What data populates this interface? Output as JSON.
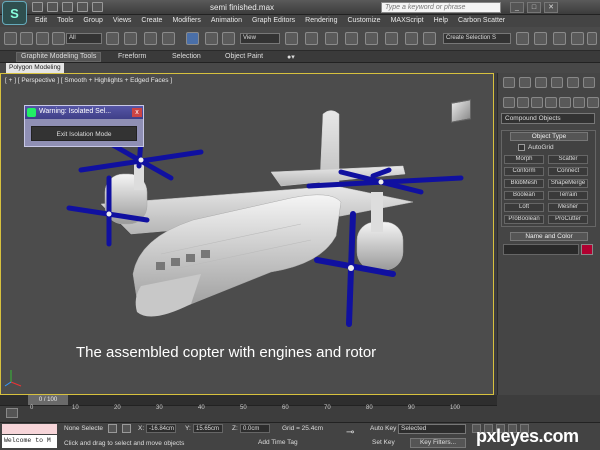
{
  "title": "semi finished.max",
  "app_logo": "S",
  "search_placeholder": "Type a keyword or phrase",
  "window_controls": [
    "_",
    "□",
    "✕"
  ],
  "menu": [
    "Edit",
    "Tools",
    "Group",
    "Views",
    "Create",
    "Modifiers",
    "Animation",
    "Graph Editors",
    "Rendering",
    "Customize",
    "MAXScript",
    "Help",
    "Carbon Scatter"
  ],
  "toolbar": {
    "filter_all": "All",
    "ref_coord": "View",
    "selection_set": "Create Selection S"
  },
  "ribbon": {
    "tabs": [
      "Graphite Modeling Tools",
      "Freeform",
      "Selection",
      "Object Paint"
    ],
    "active_tab": 0,
    "sub_tab": "Polygon Modeling"
  },
  "viewport": {
    "label": "[ + ] [ Perspective ] [ Smooth + Highlights + Edged Faces ]",
    "caption": "The assembled copter with engines and rotor"
  },
  "isolate_dialog": {
    "title": "Warning: Isolated Sel...",
    "close": "x",
    "button": "Exit Isolation Mode"
  },
  "command_panel": {
    "dropdown": "Compound Objects",
    "object_type_header": "Object Type",
    "autogrid": "AutoGrid",
    "buttons": [
      [
        "Morph",
        "Scatter"
      ],
      [
        "Conform",
        "Connect"
      ],
      [
        "BlobMesh",
        "ShapeMerge"
      ],
      [
        "Boolean",
        "Terrain"
      ],
      [
        "Loft",
        "Mesher"
      ],
      [
        "ProBoolean",
        "ProCutter"
      ]
    ],
    "name_color_header": "Name and Color",
    "object_color": "#b00030"
  },
  "timeline": {
    "frame": "0 / 100",
    "ticks": [
      "0",
      "10",
      "20",
      "30",
      "40",
      "50",
      "60",
      "70",
      "80",
      "90",
      "100"
    ]
  },
  "status": {
    "listener": "Welcome to M",
    "selection": "None Selecte",
    "hint": "Click and drag to select and move objects",
    "x_label": "X:",
    "x_value": "-16.84cm",
    "y_label": "Y:",
    "y_value": "15.65cm",
    "z_label": "Z:",
    "z_value": "0.0cm",
    "grid": "Grid = 25.4cm",
    "add_time_tag": "Add Time Tag",
    "auto_key": "Auto Key",
    "set_key": "Set Key",
    "key_mode": "Selected",
    "key_filters": "Key Filters..."
  },
  "watermark": "pxleyes.com"
}
